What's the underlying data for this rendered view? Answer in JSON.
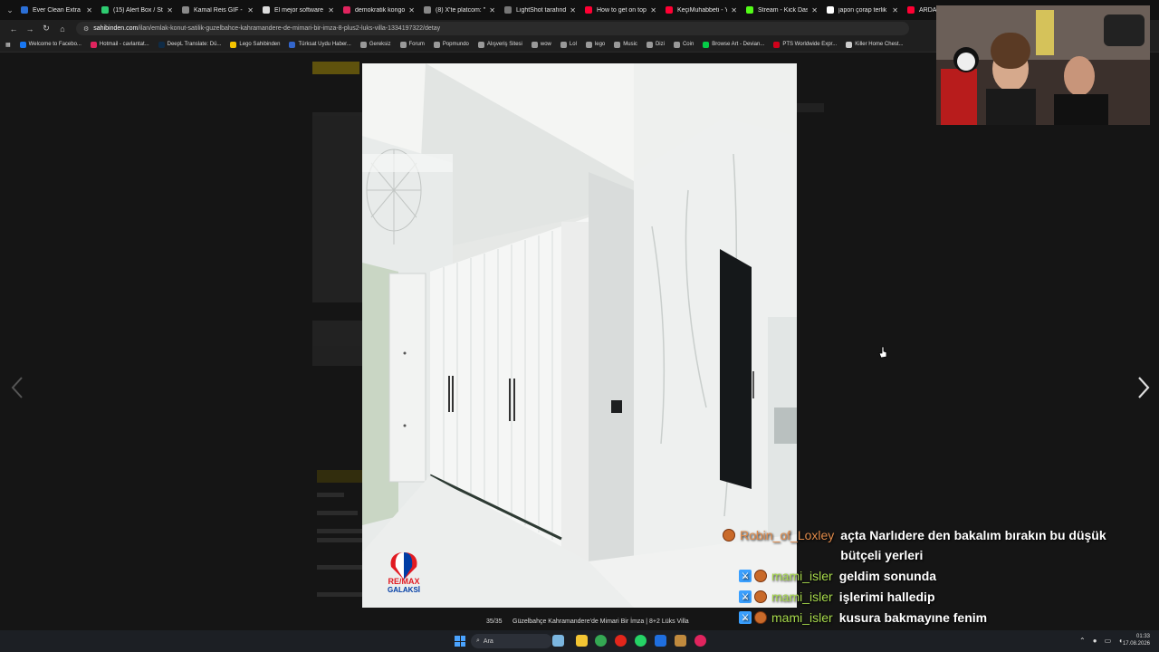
{
  "browser": {
    "tabs": [
      {
        "title": "Ever Clean Extra Str",
        "color": "#2b6fd6"
      },
      {
        "title": "(15) Alert Box / Stre",
        "color": "#2ecc71"
      },
      {
        "title": "Kamal Reis GIF - Fir",
        "color": "#8a8a8a"
      },
      {
        "title": "El mejor software p",
        "color": "#dddddd"
      },
      {
        "title": "demokratik kongo",
        "color": "#e0245e"
      },
      {
        "title": "(8) X'te platcom: \"D",
        "color": "#888888"
      },
      {
        "title": "LightShot tarafında",
        "color": "#777777"
      },
      {
        "title": "How to get on top",
        "color": "#ff0033"
      },
      {
        "title": "KeçiMuhabbeti - Yo",
        "color": "#ff0033"
      },
      {
        "title": "Stream - Kick Dash",
        "color": "#53fc18"
      },
      {
        "title": "japon çorap terlik",
        "color": "#ffffff"
      },
      {
        "title": "ARDA TU",
        "color": "#ff0033"
      }
    ],
    "url_host": "sahibinden.com",
    "url_path": "/ilan/emlak-konut-satilik-guzelbahce-kahramandere-de-mimari-bir-imza-8-plus2-luks-villa-1334197322/detay",
    "bookmarks": [
      {
        "label": "Welcome to Facebo...",
        "color": "#1877f2"
      },
      {
        "label": "Hotmail - cavlantat...",
        "color": "#e0245e"
      },
      {
        "label": "DeepL Translate: Dü...",
        "color": "#0f2b46"
      },
      {
        "label": "Lego Sahibinden",
        "color": "#f5c400"
      },
      {
        "label": "Türksat Uydu Haber...",
        "color": "#3366cc"
      },
      {
        "label": "Gereksiz",
        "color": "#999999"
      },
      {
        "label": "Forum",
        "color": "#999999"
      },
      {
        "label": "Popmundo",
        "color": "#999999"
      },
      {
        "label": "Alışveriş Sitesi",
        "color": "#999999"
      },
      {
        "label": "wow",
        "color": "#999999"
      },
      {
        "label": "Lol",
        "color": "#999999"
      },
      {
        "label": "lego",
        "color": "#999999"
      },
      {
        "label": "Music",
        "color": "#999999"
      },
      {
        "label": "Dizi",
        "color": "#999999"
      },
      {
        "label": "Coin",
        "color": "#999999"
      },
      {
        "label": "Browse Art - Devian...",
        "color": "#05cc47"
      },
      {
        "label": "PTS Worldwide Expr...",
        "color": "#d0021b"
      },
      {
        "label": "Killer Home Chest...",
        "color": "#cccccc"
      }
    ]
  },
  "gallery": {
    "counter": "35/35",
    "caption": "Güzelbahçe Kahramandere'de Mimari Bir İmza | 8+2 Lüks Villa",
    "watermark_brand": "RE/MAX",
    "watermark_office": "GALAKSİ"
  },
  "chat": [
    {
      "user": "Robin_of_Loxley",
      "user_color": "#e08a4a",
      "text": "açta Narlıdere den bakalım bırakın bu düşük bütçeli yerleri",
      "badges": [
        "ball"
      ]
    },
    {
      "user": "mami_isler",
      "user_color": "#a6d94a",
      "text": "geldim sonunda",
      "badges": [
        "sword",
        "ball"
      ]
    },
    {
      "user": "mami_isler",
      "user_color": "#a6d94a",
      "text": "işlerimi halledip",
      "badges": [
        "sword",
        "ball"
      ]
    },
    {
      "user": "mami_isler",
      "user_color": "#a6d94a",
      "text": "kusura bakmayıne fenim",
      "badges": [
        "sword",
        "ball"
      ]
    }
  ],
  "taskbar": {
    "search_placeholder": "Ara",
    "time": "01:33",
    "date": "17.08.2026"
  }
}
